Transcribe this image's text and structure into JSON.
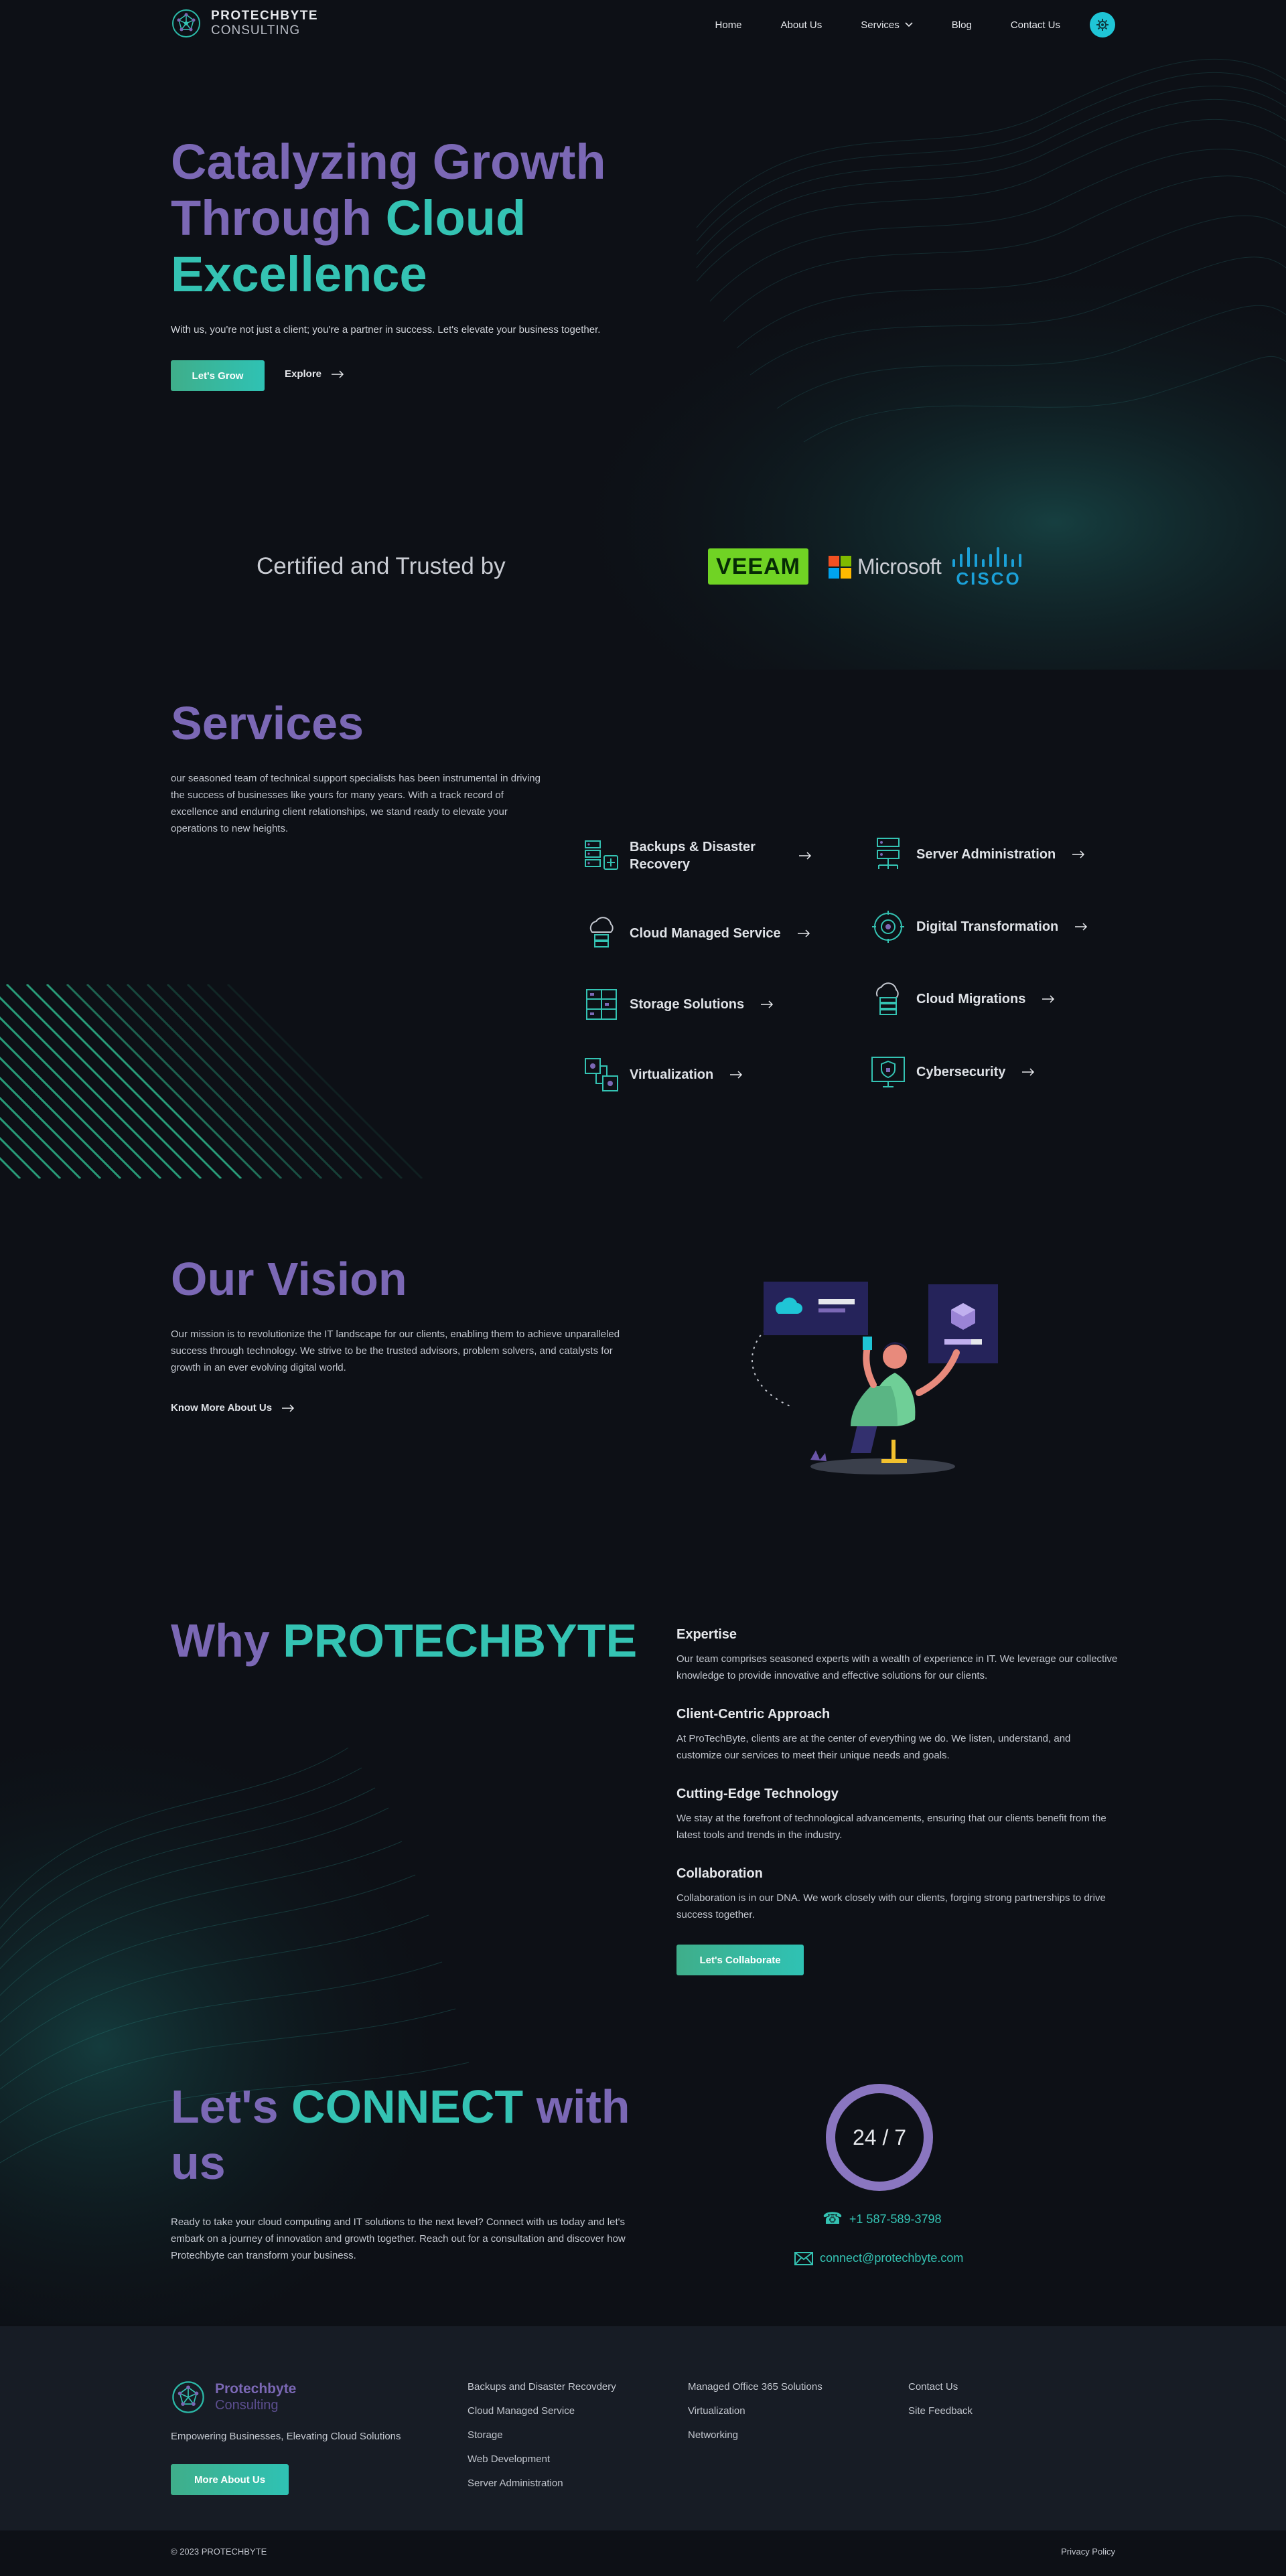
{
  "header": {
    "brand_line1": "PROTECHBYTE",
    "brand_line2": "CONSULTING",
    "nav": [
      "Home",
      "About Us",
      "Services",
      "Blog",
      "Contact Us"
    ]
  },
  "hero": {
    "title_line1": "Catalyzing Growth",
    "title_line2a": "Through ",
    "title_line2b": "Cloud",
    "title_line3": "Excellence",
    "subtitle": "With us, you're not just a client; you're a partner in success. Let's elevate your business together.",
    "primary_button": "Let's Grow",
    "secondary_link": "Explore"
  },
  "certified": {
    "text": "Certified and Trusted by",
    "logos": [
      "VEEAM",
      "Microsoft",
      "CISCO"
    ]
  },
  "services": {
    "title": "Services",
    "description": "our seasoned team of technical support specialists has been instrumental in driving the success of businesses like yours for many years. With a track record of excellence and enduring client relationships, we stand ready to elevate your operations to new heights.",
    "items": [
      {
        "label": "Backups & Disaster Recovery",
        "icon": "backup-server-icon"
      },
      {
        "label": "Server Administration",
        "icon": "server-rack-icon"
      },
      {
        "label": "Cloud Managed Service",
        "icon": "cloud-server-icon"
      },
      {
        "label": "Digital Transformation",
        "icon": "digital-chip-icon"
      },
      {
        "label": "Storage Solutions",
        "icon": "storage-icon"
      },
      {
        "label": "Cloud Migrations",
        "icon": "cloud-migration-icon"
      },
      {
        "label": "Virtualization",
        "icon": "virtualization-icon"
      },
      {
        "label": "Cybersecurity",
        "icon": "security-shield-icon"
      }
    ]
  },
  "vision": {
    "title": "Our Vision",
    "description": "Our mission is to revolutionize the IT landscape for our clients, enabling them to achieve unparalleled success through technology. We strive to be the trusted advisors, problem solvers, and catalysts for growth in an ever evolving digital world.",
    "link": "Know More About Us"
  },
  "why": {
    "title_a": "Why ",
    "title_b": "PROTECHBYTE",
    "points": [
      {
        "heading": "Expertise",
        "text": "Our team comprises seasoned experts with a wealth of experience in IT. We leverage our collective knowledge to provide innovative and effective solutions for our clients."
      },
      {
        "heading": "Client-Centric Approach",
        "text": "At ProTechByte, clients are at the center of everything we do. We listen, understand, and customize our services to meet their unique needs and goals."
      },
      {
        "heading": "Cutting-Edge Technology",
        "text": "We stay at the forefront of technological advancements, ensuring that our clients benefit from the latest tools and trends in the industry."
      },
      {
        "heading": "Collaboration",
        "text": "Collaboration is in our DNA. We work closely with our clients, forging strong partnerships to drive success together."
      }
    ],
    "button": "Let's Collaborate"
  },
  "connect": {
    "title_a": "Let's ",
    "title_b": "CONNECT",
    "title_c": " with us",
    "description": "Ready to take your cloud computing and IT solutions to the next level? Connect with us today and let's embark on a journey of innovation and growth together. Reach out for a consultation and discover how Protechbyte can transform your business.",
    "availability": "24 / 7",
    "phone": "+1 587-589-3798",
    "email": "connect@protechbyte.com"
  },
  "footer": {
    "brand_line1": "Protechbyte",
    "brand_line2": "Consulting",
    "tagline": "Empowering Businesses, Elevating Cloud Solutions",
    "button": "More About Us",
    "col1": [
      "Backups and Disaster Recovdery",
      "Cloud Managed Service",
      "Storage",
      "Web Development",
      "Server Administration"
    ],
    "col2": [
      "Managed Office 365 Solutions",
      "Virtualization",
      "Networking"
    ],
    "col3": [
      "Contact Us",
      "Site Feedback"
    ],
    "copyright": "© 2023 PROTECHBYTE",
    "privacy": "Privacy Policy"
  },
  "colors": {
    "background": "#0d1016",
    "purple": "#7b68b5",
    "teal": "#34c3b3",
    "button_gradient_start": "#3fae8a",
    "button_gradient_end": "#2fc2b4"
  }
}
